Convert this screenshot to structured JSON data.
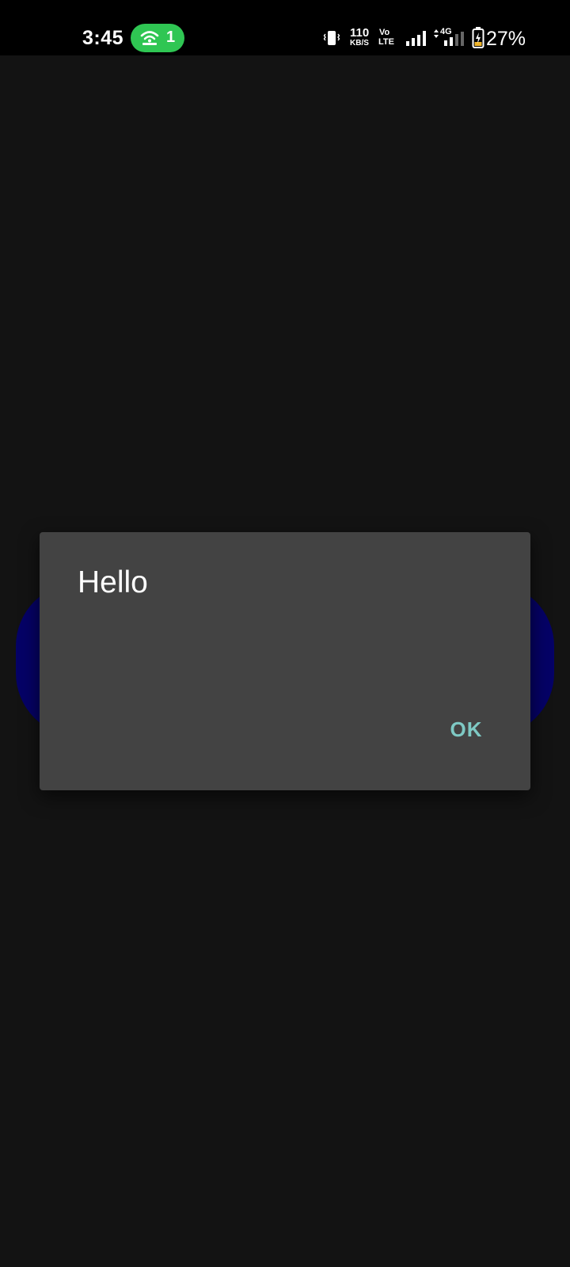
{
  "status_bar": {
    "time": "3:45",
    "hotspot_count": "1",
    "speed_value": "110",
    "speed_unit": "KB/S",
    "volte_top": "Vo",
    "volte_bottom": "LTE",
    "network_type": "4G",
    "battery_percent": "27%",
    "icons": [
      "hotspot-icon",
      "vibrate-icon",
      "signal-icon",
      "signal-4g-icon",
      "battery-charging-icon"
    ]
  },
  "dialog": {
    "title": "Hello",
    "ok_label": "OK"
  },
  "colors": {
    "background": "#131313",
    "status_bar": "#000000",
    "hotspot_pill": "#2fc653",
    "dialog": "#434343",
    "button_background": "#050266",
    "accent": "#7ec9c4"
  }
}
